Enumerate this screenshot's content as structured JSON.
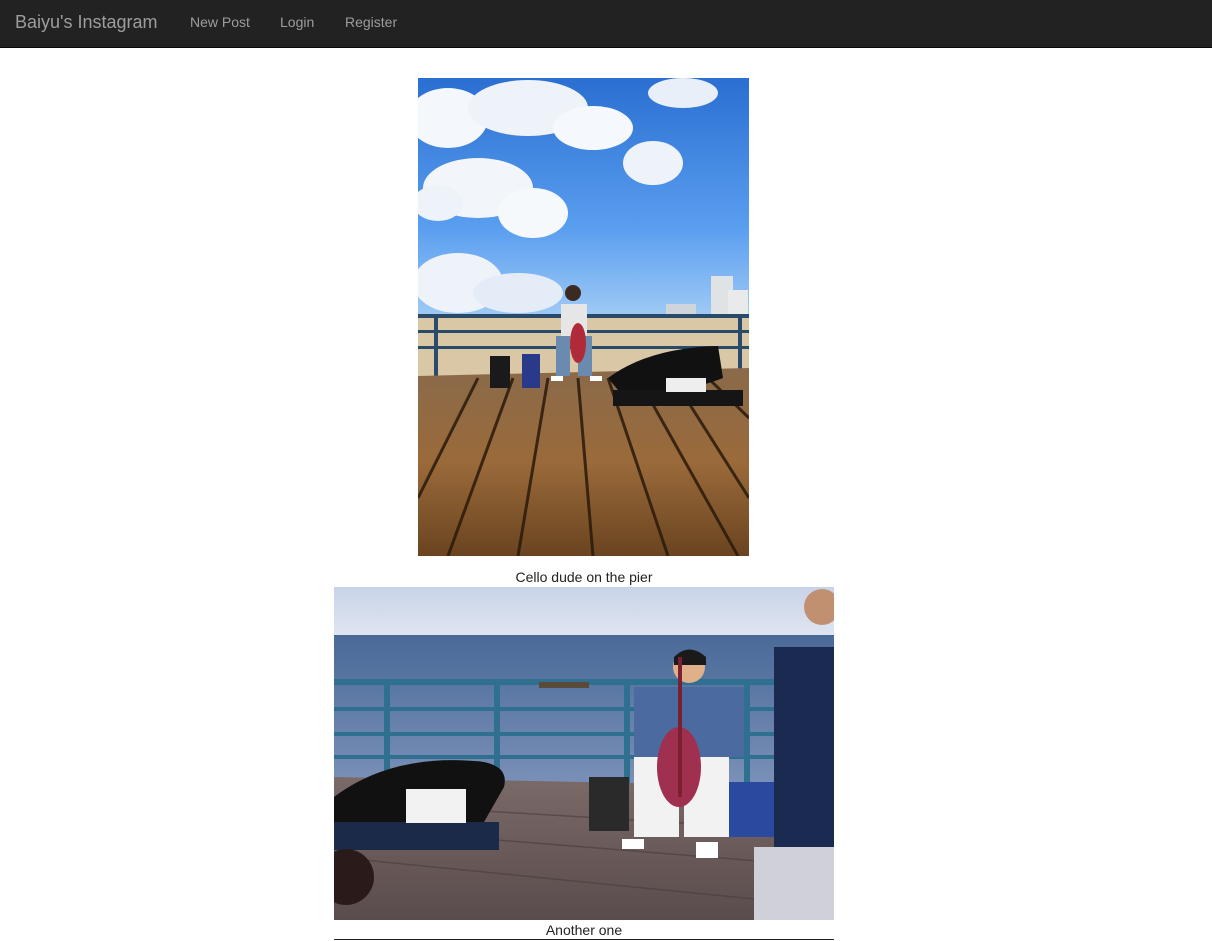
{
  "navbar": {
    "brand": "Baiyu's Instagram",
    "links": [
      "New Post",
      "Login",
      "Register"
    ]
  },
  "posts": [
    {
      "caption": "Cello dude on the pier",
      "image": "photo of a cellist playing on a wooden pier under a blue sky with clouds"
    },
    {
      "caption": "Another one",
      "image": "photo of a cellist with an electric cello on a pier by the ocean, open cello case in foreground"
    }
  ],
  "colors": {
    "navbar_bg": "#222222",
    "nav_text": "#9d9d9d"
  }
}
